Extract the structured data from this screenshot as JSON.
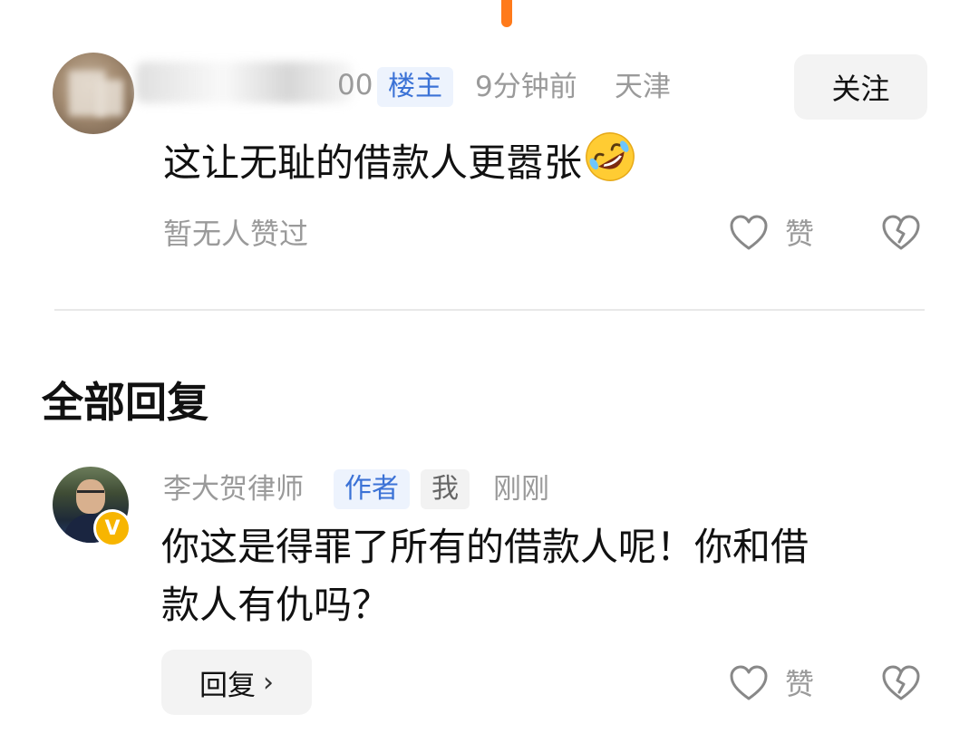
{
  "main_comment": {
    "username_visible_tail": "00",
    "owner_badge": "楼主",
    "time": "9分钟前",
    "location": "天津",
    "follow_label": "关注",
    "text": "这让无耻的借款人更嚣张",
    "likes_status": "暂无人赞过",
    "like_label": "赞",
    "emoji": "rolling-on-floor-laughing"
  },
  "replies_section": {
    "title": "全部回复"
  },
  "reply": {
    "username": "李大贺律师",
    "author_badge": "作者",
    "me_badge": "我",
    "time": "刚刚",
    "verified_mark": "V",
    "text_line1": "你这是得罪了所有的借款人呢！你和借",
    "text_line2": "款人有仇吗？",
    "reply_button": "回复",
    "reply_chevron": "›",
    "like_label": "赞"
  },
  "colors": {
    "accent_orange": "#ff7a1a",
    "badge_blue": "#3b72d6",
    "verified_gold": "#f7b500",
    "muted_text": "#9a9a9a"
  }
}
